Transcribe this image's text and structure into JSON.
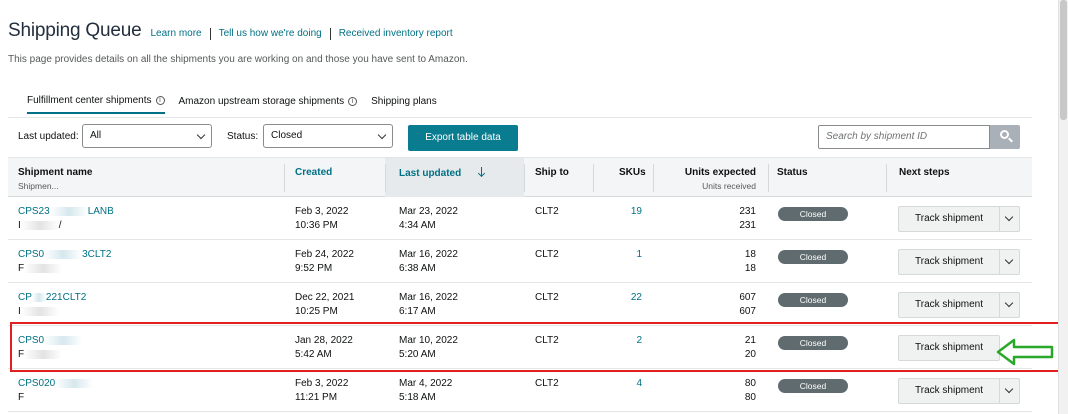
{
  "header": {
    "title": "Shipping Queue",
    "links": [
      "Learn more",
      "Tell us how we're doing",
      "Received inventory report"
    ]
  },
  "description": "This page provides details on all the shipments you are working on and those you have sent to Amazon.",
  "tabs": [
    {
      "label": "Fulfillment center shipments",
      "active": true
    },
    {
      "label": "Amazon upstream storage shipments",
      "active": false
    },
    {
      "label": "Shipping plans",
      "active": false
    }
  ],
  "filters": {
    "last_updated_label": "Last updated:",
    "last_updated_value": "All",
    "status_label": "Status:",
    "status_value": "Closed",
    "export_label": "Export table data",
    "search_placeholder": "Search by shipment ID"
  },
  "columns": {
    "shipment_name": "Shipment name",
    "shipment_sub": "Shipmen...",
    "created": "Created",
    "last_updated": "Last updated",
    "ship_to": "Ship to",
    "skus": "SKUs",
    "units_expected": "Units expected",
    "units_received": "Units received",
    "status": "Status",
    "next_steps": "Next steps"
  },
  "rows": [
    {
      "name": "CPS23",
      "name_tail": "LANB",
      "id": "I",
      "id_tail": "/",
      "created_date": "Feb 3, 2022",
      "created_time": "10:36 PM",
      "updated_date": "Mar 23, 2022",
      "updated_time": "4:34 AM",
      "ship_to": "CLT2",
      "skus": "19",
      "units_expected": "231",
      "units_received": "231",
      "status": "Closed",
      "action": "Track shipment"
    },
    {
      "name": "CPS0",
      "name_tail": "3CLT2",
      "id": "F",
      "id_tail": "",
      "created_date": "Feb 24, 2022",
      "created_time": "9:52 PM",
      "updated_date": "Mar 16, 2022",
      "updated_time": "6:38 AM",
      "ship_to": "CLT2",
      "skus": "1",
      "units_expected": "18",
      "units_received": "18",
      "status": "Closed",
      "action": "Track shipment"
    },
    {
      "name": "CP",
      "name_tail": "221CLT2",
      "id": "I",
      "id_tail": "",
      "created_date": "Dec 22, 2021",
      "created_time": "10:25 PM",
      "updated_date": "Mar 16, 2022",
      "updated_time": "6:17 AM",
      "ship_to": "CLT2",
      "skus": "22",
      "units_expected": "607",
      "units_received": "607",
      "status": "Closed",
      "action": "Track shipment"
    },
    {
      "name": "CPS0",
      "name_tail": "",
      "id": "F",
      "id_tail": "",
      "created_date": "Jan 28, 2022",
      "created_time": "5:42 AM",
      "updated_date": "Mar 10, 2022",
      "updated_time": "5:20 AM",
      "ship_to": "CLT2",
      "skus": "2",
      "units_expected": "21",
      "units_received": "20",
      "status": "Closed",
      "action": "Track shipment"
    },
    {
      "name": "CPS020",
      "name_tail": "",
      "id": "F",
      "id_tail": "",
      "created_date": "Feb 3, 2022",
      "created_time": "11:21 PM",
      "updated_date": "Mar 4, 2022",
      "updated_time": "5:18 AM",
      "ship_to": "CLT2",
      "skus": "4",
      "units_expected": "80",
      "units_received": "80",
      "status": "Closed",
      "action": "Track shipment"
    }
  ],
  "colors": {
    "accent": "#007185",
    "export_button": "#0a7c8f",
    "status_badge": "#5f6b6e",
    "highlight": "#e02020",
    "annotation_arrow": "#2aa82a"
  }
}
